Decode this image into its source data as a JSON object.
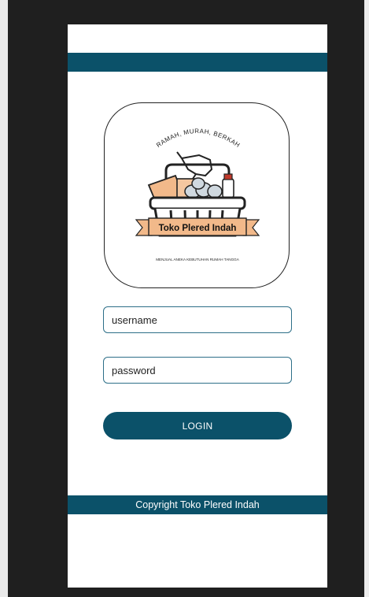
{
  "logo": {
    "tagline": "RAMAH, MURAH, BERKAH",
    "brand_name": "Toko Plered Indah",
    "subtitle": "MENJUAL ANEKA KEBUTUHAN RUMAH TANGGA"
  },
  "form": {
    "username_placeholder": "username",
    "password_placeholder": "password",
    "login_label": "LOGIN"
  },
  "footer": {
    "copyright": "Copyright Toko Plered Indah"
  },
  "colors": {
    "primary": "#0b5169",
    "ribbon": "#f2b98a",
    "frame": "#1f1f1f"
  }
}
